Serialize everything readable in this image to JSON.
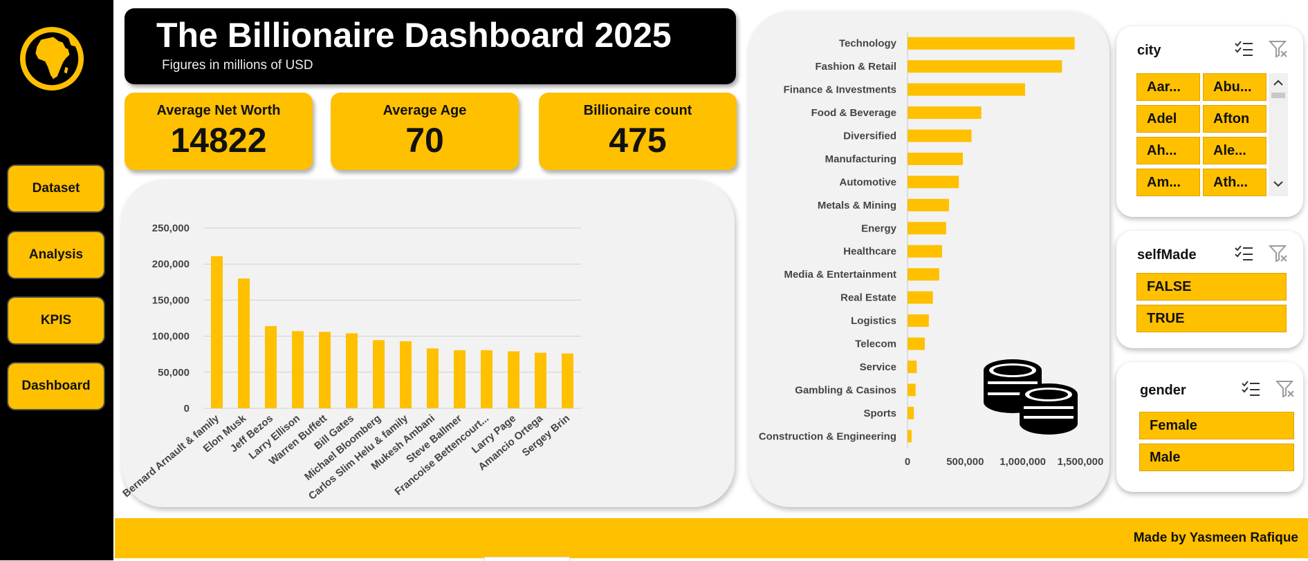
{
  "header": {
    "title": "The Billionaire Dashboard 2025",
    "subtitle": "Figures in millions of USD"
  },
  "sidebar": {
    "logo_icon": "globe-africa-icon",
    "items": [
      {
        "label": "Dataset"
      },
      {
        "label": "Analysis"
      },
      {
        "label": "KPIS"
      },
      {
        "label": "Dashboard"
      }
    ]
  },
  "kpis": [
    {
      "label": "Average Net Worth",
      "value": "14822"
    },
    {
      "label": "Average Age",
      "value": "70"
    },
    {
      "label": "Billionaire count",
      "value": "475"
    }
  ],
  "slicers": {
    "city": {
      "title": "city",
      "items": [
        "Aar...",
        "Abu...",
        "Adel",
        "Afton",
        "Ah...",
        "Ale...",
        "Am...",
        "Ath..."
      ]
    },
    "selfMade": {
      "title": "selfMade",
      "items": [
        "FALSE",
        "TRUE"
      ]
    },
    "gender": {
      "title": "gender",
      "items": [
        "Female",
        "Male"
      ]
    },
    "icons": [
      "multi-select-icon",
      "clear-filter-icon"
    ]
  },
  "footer": {
    "text": "Made by Yasmeen Rafique"
  },
  "colors": {
    "accent": "#ffc000",
    "dark": "#000000",
    "panel": "#f2f2f2"
  },
  "decor_icon": "coin-stack-icon",
  "chart_data": [
    {
      "type": "bar",
      "categories": [
        "Bernard Arnault & family",
        "Elon Musk",
        "Jeff Bezos",
        "Larry Ellison",
        "Warren Buffett",
        "Bill Gates",
        "Michael Bloomberg",
        "Carlos Slim Helu & family",
        "Mukesh Ambani",
        "Steve Ballmer",
        "Francoise Bettencourt...",
        "Larry Page",
        "Amancio Ortega",
        "Sergey Brin"
      ],
      "values": [
        211000,
        180000,
        114000,
        107000,
        106000,
        104000,
        94500,
        93000,
        83000,
        80500,
        80500,
        79000,
        77000,
        76000
      ],
      "yticks": [
        "0",
        "50,000",
        "100,000",
        "150,000",
        "200,000",
        "250,000"
      ],
      "ylim": [
        0,
        250000
      ],
      "grid": true,
      "title": "",
      "xlabel": "",
      "ylabel": ""
    },
    {
      "type": "bar",
      "orientation": "horizontal",
      "categories": [
        "Technology",
        "Fashion & Retail",
        "Finance & Investments",
        "Food & Beverage",
        "Diversified",
        "Manufacturing",
        "Automotive",
        "Metals & Mining",
        "Energy",
        "Healthcare",
        "Media & Entertainment",
        "Real Estate",
        "Logistics",
        "Telecom",
        "Service",
        "Gambling & Casinos",
        "Sports",
        "Construction & Engineering"
      ],
      "values": [
        1450000,
        1340000,
        1020000,
        640000,
        555000,
        480000,
        445000,
        360000,
        335000,
        300000,
        275000,
        220000,
        185000,
        150000,
        80000,
        70000,
        55000,
        35000
      ],
      "xticks": [
        "0",
        "500,000",
        "1,000,000",
        "1,500,000"
      ],
      "xlim": [
        0,
        1500000
      ],
      "grid": false,
      "title": "",
      "xlabel": "",
      "ylabel": ""
    }
  ]
}
